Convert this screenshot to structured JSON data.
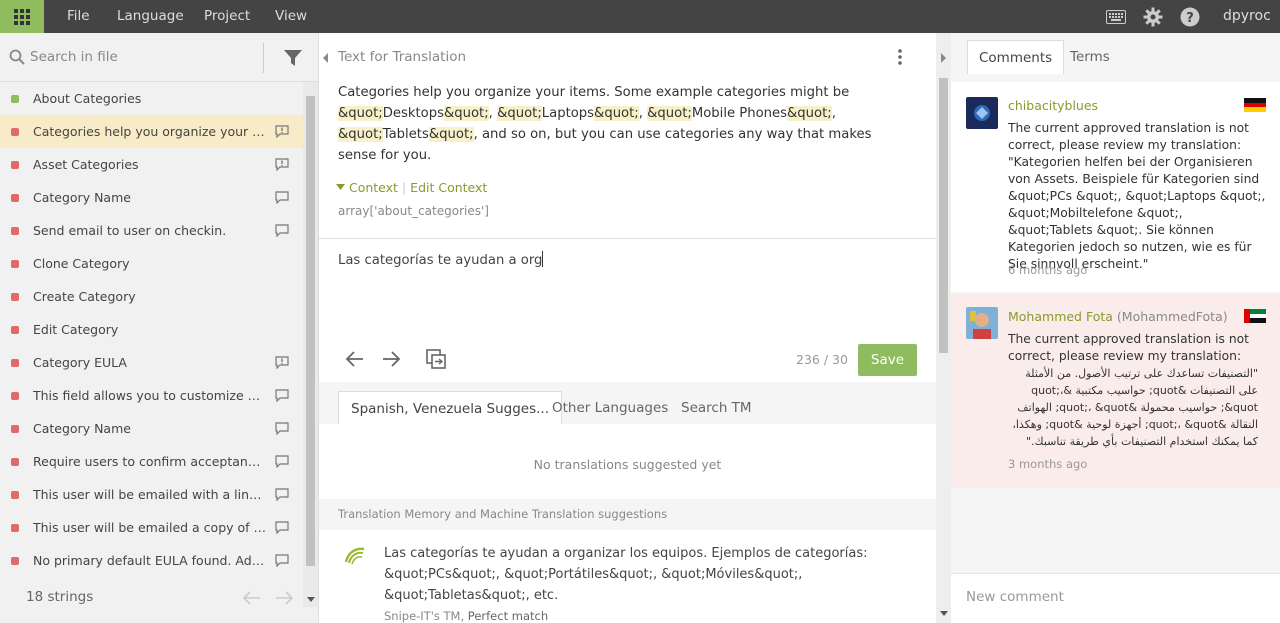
{
  "menu": {
    "file": "File",
    "language": "Language",
    "project": "Project",
    "view": "View",
    "user": "dpyroc"
  },
  "sidebar": {
    "search_placeholder": "Search in file",
    "items": [
      {
        "label": "About Categories",
        "status": "green",
        "icon": ""
      },
      {
        "label": "Categories help you organize your item...",
        "status": "red",
        "icon": "issue-icon",
        "active": true
      },
      {
        "label": "Asset Categories",
        "status": "red",
        "icon": "issue-icon"
      },
      {
        "label": "Category Name",
        "status": "red",
        "icon": "comment-icon"
      },
      {
        "label": "Send email to user on checkin.",
        "status": "red",
        "icon": "comment-icon"
      },
      {
        "label": "Clone Category",
        "status": "red",
        "icon": ""
      },
      {
        "label": "Create Category",
        "status": "red",
        "icon": ""
      },
      {
        "label": "Edit Category",
        "status": "red",
        "icon": ""
      },
      {
        "label": "Category EULA",
        "status": "red",
        "icon": "issue-icon"
      },
      {
        "label": "This field allows you to customize your ...",
        "status": "red",
        "icon": "comment-icon"
      },
      {
        "label": "Category Name",
        "status": "red",
        "icon": "comment-icon"
      },
      {
        "label": "Require users to confirm acceptance of ...",
        "status": "red",
        "icon": "comment-icon"
      },
      {
        "label": "This user will be emailed with a link to c...",
        "status": "red",
        "icon": "comment-icon"
      },
      {
        "label": "This user will be emailed a copy of the E...",
        "status": "red",
        "icon": "comment-icon"
      },
      {
        "label": "No primary default EULA found. Add on...",
        "status": "red",
        "icon": "comment-icon"
      }
    ],
    "count": "18 strings"
  },
  "source": {
    "header": "Text for Translation",
    "segments": [
      {
        "t": "Categories help you organize your items. Some example categories might be ",
        "h": false
      },
      {
        "t": "&quot;",
        "h": true
      },
      {
        "t": "Desktops",
        "h": false
      },
      {
        "t": "&quot;",
        "h": true
      },
      {
        "t": ", ",
        "h": false
      },
      {
        "t": "&quot;",
        "h": true
      },
      {
        "t": "Laptops",
        "h": false
      },
      {
        "t": "&quot;",
        "h": true
      },
      {
        "t": ", ",
        "h": false
      },
      {
        "t": "&quot;",
        "h": true
      },
      {
        "t": "Mobile Phones",
        "h": false
      },
      {
        "t": "&quot;",
        "h": true
      },
      {
        "t": ", ",
        "h": false
      },
      {
        "t": "&quot;",
        "h": true
      },
      {
        "t": "Tablets",
        "h": false
      },
      {
        "t": "&quot;",
        "h": true
      },
      {
        "t": ", and so on, but you can use categories any way that makes sense for you.",
        "h": false
      }
    ],
    "context_label": "Context",
    "edit_context": "Edit Context",
    "context_value": "array['about_categories']"
  },
  "translation": {
    "value": "Las categorías te ayudan a org",
    "counter": "236 / 30",
    "save": "Save"
  },
  "suggestions": {
    "tabs": [
      "Spanish, Venezuela Sugges...",
      "Other Languages",
      "Search TM"
    ],
    "empty": "No translations suggested yet",
    "tm_label": "Translation Memory and Machine Translation suggestions",
    "tm_text": "Las categorías te ayudan a organizar los equipos. Ejemplos de categorías: &quot;PCs&quot;, &quot;Portátiles&quot;, &quot;Móviles&quot;, &quot;Tabletas&quot;, etc.",
    "tm_source": "Snipe-IT's TM, ",
    "tm_match": "Perfect match"
  },
  "right": {
    "tabs": [
      "Comments",
      "Terms"
    ],
    "comments": [
      {
        "name": "chibacityblues",
        "handle": "",
        "flag": "germany",
        "text": "The current approved translation is not correct, please review my translation: \"Kategorien helfen bei der Organisieren von Assets. Beispiele für Kategorien sind &quot;PCs &quot;, &quot;Laptops &quot;, &quot;Mobiltelefone &quot;, &quot;Tablets &quot;. Sie können Kategorien jedoch so nutzen, wie es für Sie sinnvoll erscheint.\"",
        "time": "6 months ago"
      },
      {
        "name": "Mohammed Fota",
        "handle": "(MohammedFota)",
        "flag": "uae",
        "text_intro": "The current approved translation is not correct, please review my translation:",
        "text_rtl": "\"التصنيفات تساعدك على ترتيب الأصول. من الأمثلة على التصنيفات &quot; حواسيب مكتبية &quot;، &quot; حواسيب محمولة &quot;، &quot; الهواتف النقالة &quot;، &quot; أجهزة لوحية &quot; وهكذا، كما يمكنك استخدام التصنيفات بأي طريقة تناسبك.\"",
        "time": "3 months ago"
      }
    ],
    "new_comment_placeholder": "New comment"
  },
  "colors": {
    "accent": "#8fbc5e",
    "topbar": "#444444",
    "status_red": "#e06a6a",
    "status_green": "#8fbc5e",
    "highlight": "#f8f0c8",
    "active_row": "#f8ecc8"
  }
}
